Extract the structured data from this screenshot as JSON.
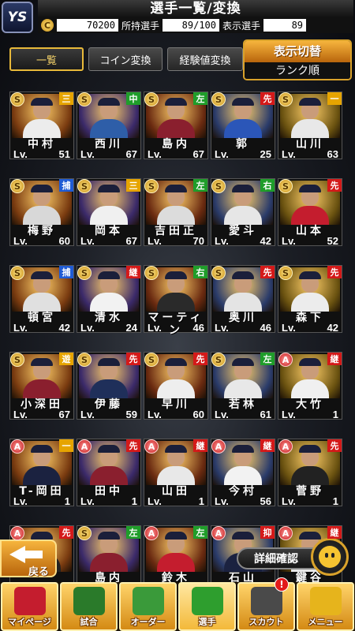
{
  "header": {
    "logo": "YS",
    "title": "選手一覧/変換",
    "coins": "70200",
    "owned_label": "所持選手",
    "owned_value": "89/100",
    "display_label": "表示選手",
    "display_value": "89"
  },
  "tabs": [
    {
      "label": "一覧"
    },
    {
      "label": "コイン変換"
    },
    {
      "label": "経験値変換"
    }
  ],
  "sort": {
    "title": "表示切替",
    "value": "ランク順"
  },
  "colors": {
    "pos_infield": "#e6a400",
    "pos_outfield": "#1f9d2a",
    "pos_pitcher": "#d41919",
    "pos_catcher": "#1f5bd4"
  },
  "cards": [
    {
      "rank": "S",
      "pos": "三",
      "name": "中村",
      "lv": "51",
      "uniform": "#ececec"
    },
    {
      "rank": "S",
      "pos": "中",
      "name": "西川",
      "lv": "67",
      "uniform": "#2e5ea8"
    },
    {
      "rank": "S",
      "pos": "左",
      "name": "島内",
      "lv": "67",
      "uniform": "#8a1f2e"
    },
    {
      "rank": "S",
      "pos": "先",
      "name": "郭",
      "lv": "25",
      "uniform": "#2b56b8"
    },
    {
      "rank": "S",
      "pos": "一",
      "name": "山川",
      "lv": "63",
      "uniform": "#e8e8e8"
    },
    {
      "rank": "S",
      "pos": "捕",
      "name": "梅野",
      "lv": "60",
      "uniform": "#d8d8d8"
    },
    {
      "rank": "S",
      "pos": "三",
      "name": "岡本",
      "lv": "67",
      "uniform": "#f0f0f0"
    },
    {
      "rank": "S",
      "pos": "左",
      "name": "吉田正",
      "lv": "70",
      "uniform": "#dcdcdc"
    },
    {
      "rank": "S",
      "pos": "右",
      "name": "愛斗",
      "lv": "42",
      "uniform": "#e6e6e6"
    },
    {
      "rank": "S",
      "pos": "先",
      "name": "山本",
      "lv": "52",
      "uniform": "#c41d2e"
    },
    {
      "rank": "S",
      "pos": "捕",
      "name": "頓宮",
      "lv": "42",
      "uniform": "#e0e0e0"
    },
    {
      "rank": "S",
      "pos": "継",
      "name": "清水",
      "lv": "24",
      "uniform": "#f2f2f2"
    },
    {
      "rank": "S",
      "pos": "右",
      "name": "マーティン",
      "lv": "46",
      "uniform": "#2a2a2a"
    },
    {
      "rank": "S",
      "pos": "先",
      "name": "奥川",
      "lv": "46",
      "uniform": "#e4e4e4"
    },
    {
      "rank": "S",
      "pos": "先",
      "name": "森下",
      "lv": "42",
      "uniform": "#ececec"
    },
    {
      "rank": "S",
      "pos": "遊",
      "name": "小深田",
      "lv": "67",
      "uniform": "#8a1f2e"
    },
    {
      "rank": "S",
      "pos": "先",
      "name": "伊藤",
      "lv": "59",
      "uniform": "#1f2f5a"
    },
    {
      "rank": "S",
      "pos": "先",
      "name": "早川",
      "lv": "60",
      "uniform": "#eeeeee"
    },
    {
      "rank": "S",
      "pos": "左",
      "name": "若林",
      "lv": "61",
      "uniform": "#e8e8e8"
    },
    {
      "rank": "A",
      "pos": "継",
      "name": "大竹",
      "lv": "1",
      "uniform": "#f0f0f0"
    },
    {
      "rank": "A",
      "pos": "一",
      "name": "T-岡田",
      "lv": "1",
      "uniform": "#1b2240"
    },
    {
      "rank": "A",
      "pos": "先",
      "name": "田中",
      "lv": "1",
      "uniform": "#8a1f2e"
    },
    {
      "rank": "A",
      "pos": "継",
      "name": "山田",
      "lv": "1",
      "uniform": "#e8e8e8"
    },
    {
      "rank": "A",
      "pos": "継",
      "name": "今村",
      "lv": "56",
      "uniform": "#f2f2f2"
    },
    {
      "rank": "A",
      "pos": "先",
      "name": "菅野",
      "lv": "1",
      "uniform": "#222222"
    },
    {
      "rank": "A",
      "pos": "先",
      "name": "",
      "lv": "",
      "uniform": "#222222"
    },
    {
      "rank": "S",
      "pos": "左",
      "name": "島内",
      "lv": "",
      "uniform": "#8a1f2e"
    },
    {
      "rank": "A",
      "pos": "左",
      "name": "鈴木",
      "lv": "",
      "uniform": "#c41d2e"
    },
    {
      "rank": "A",
      "pos": "抑",
      "name": "石山",
      "lv": "",
      "uniform": "#1b2240"
    },
    {
      "rank": "A",
      "pos": "継",
      "name": "鍵谷",
      "lv": "",
      "uniform": "#e8e8e8"
    }
  ],
  "lv_prefix": "Lv.",
  "back": {
    "label": "戻る"
  },
  "detail": {
    "label": "詳細確認"
  },
  "nav": [
    {
      "label": "マイページ",
      "icon": "mypage-icon",
      "color": "#c41d2e"
    },
    {
      "label": "試合",
      "icon": "stadium-icon",
      "color": "#2a7a2a"
    },
    {
      "label": "オーダー",
      "icon": "order-field-icon",
      "color": "#3a9a3a"
    },
    {
      "label": "選手",
      "icon": "player-icon",
      "color": "#2e9e2e"
    },
    {
      "label": "スカウト",
      "icon": "scout-icon",
      "color": "#4a4a4a",
      "badge": "!"
    },
    {
      "label": "メニュー",
      "icon": "menu-icon",
      "color": "#e6b41c"
    }
  ]
}
